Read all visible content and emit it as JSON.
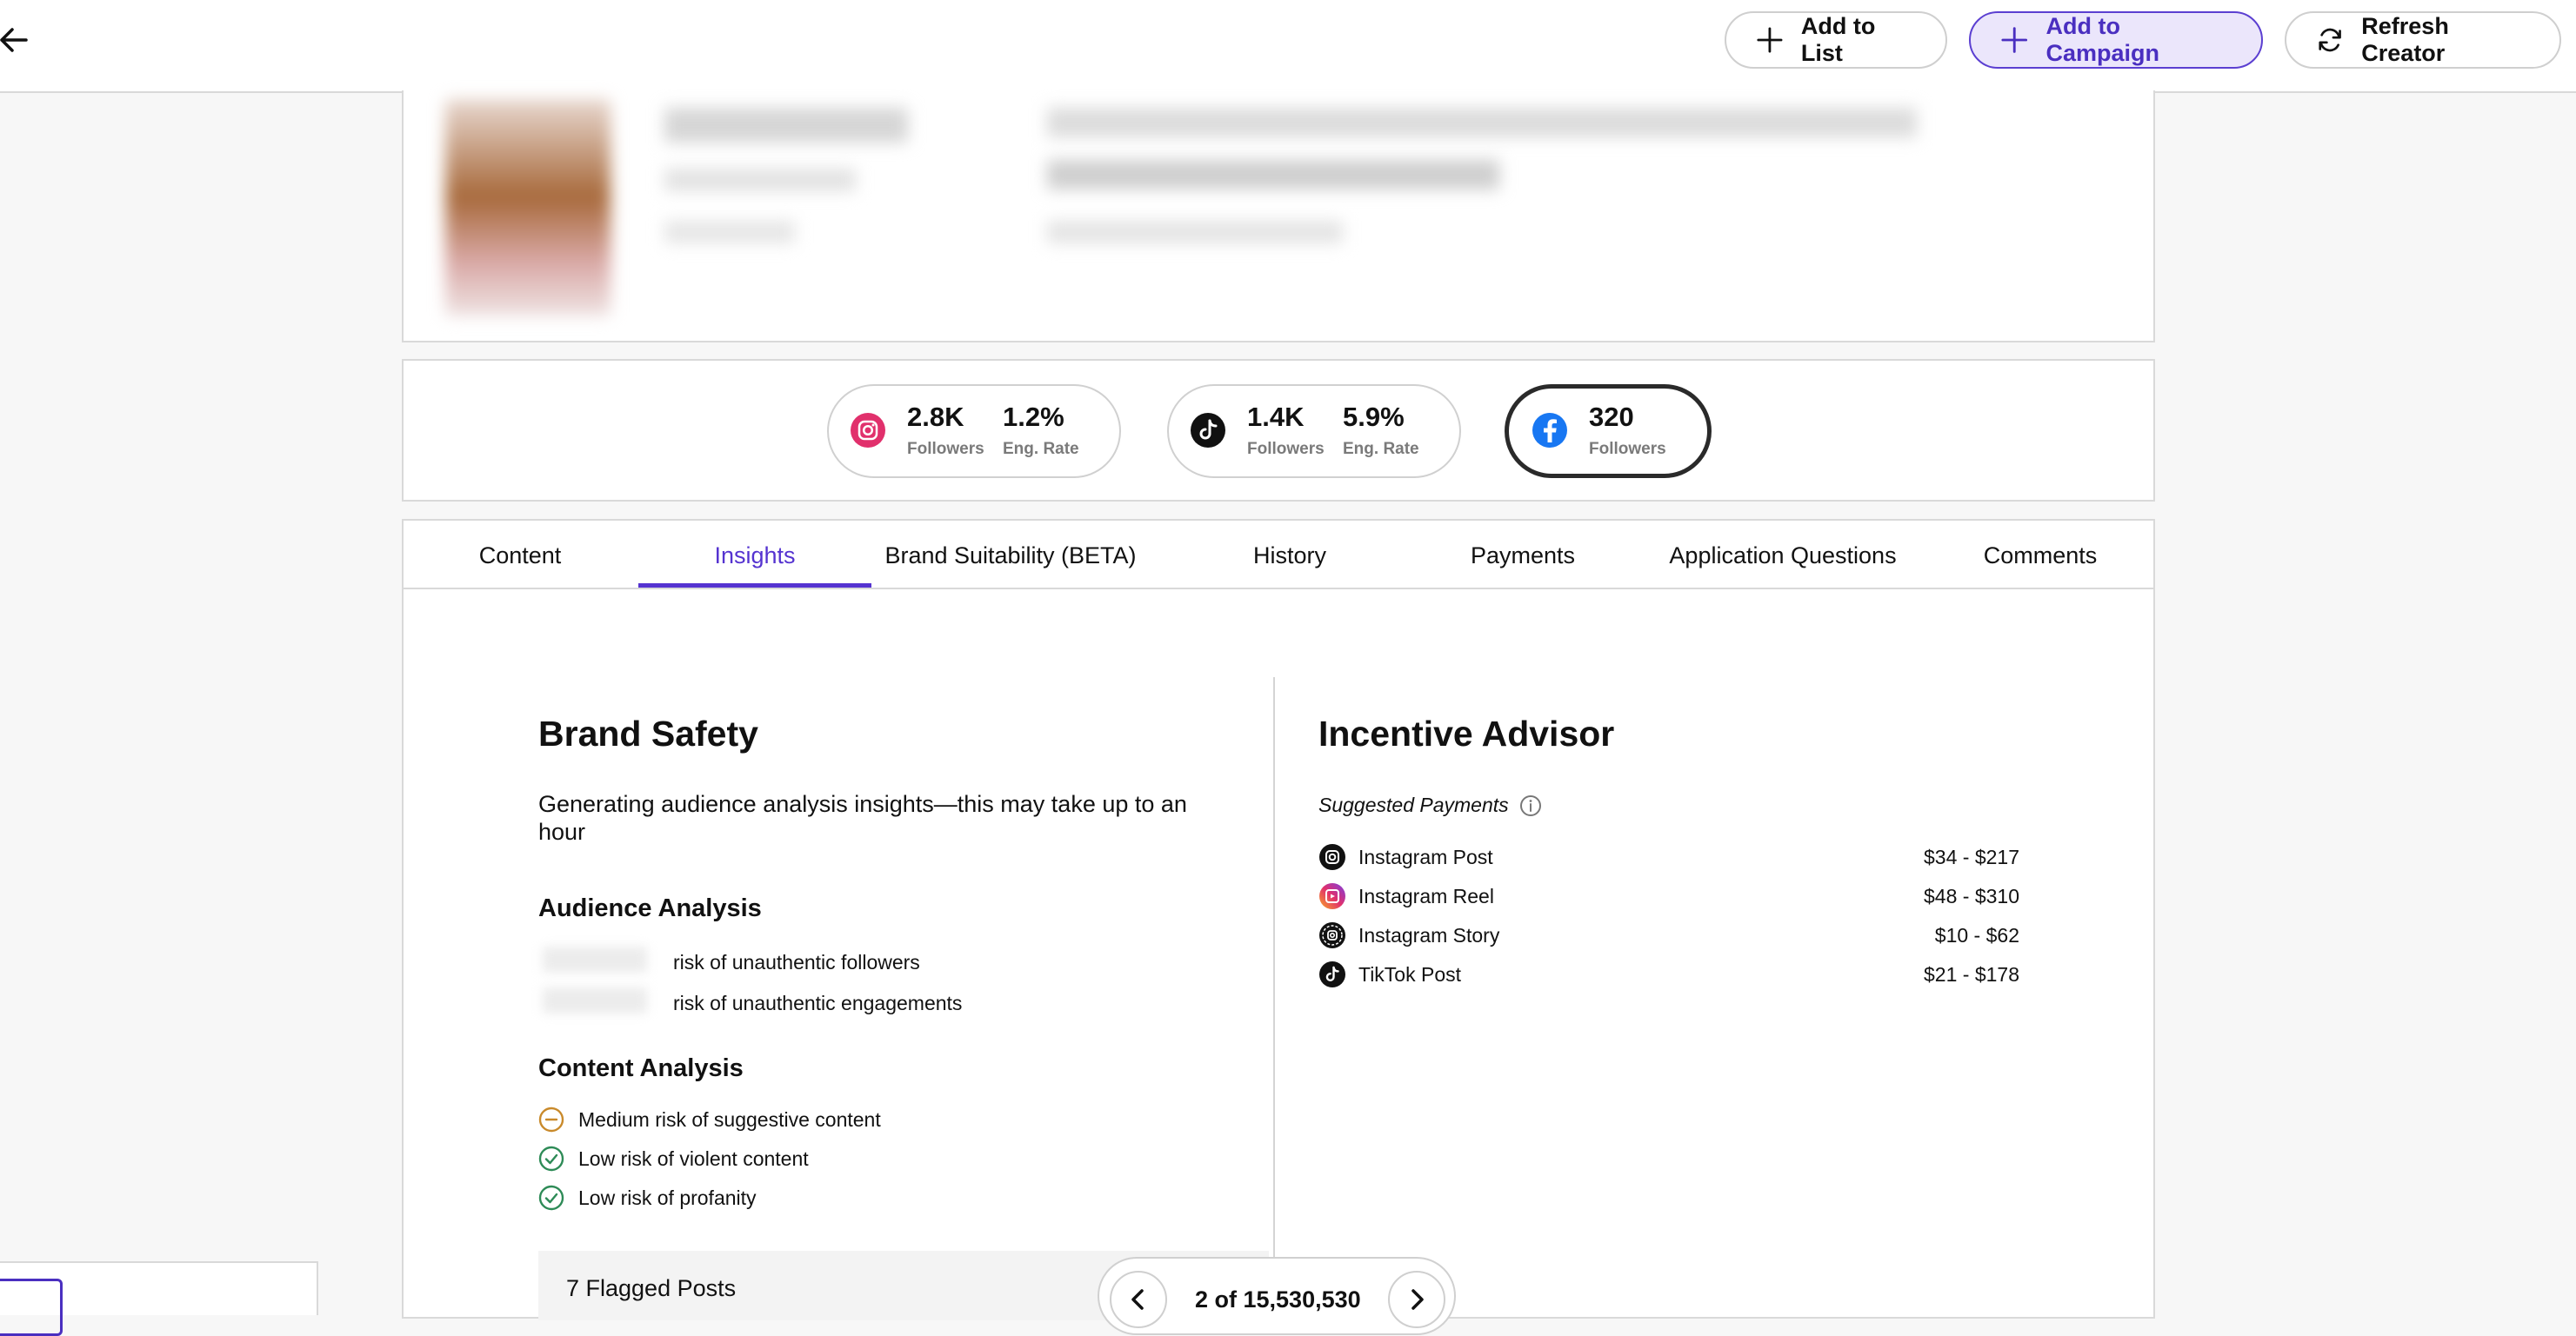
{
  "topbar": {
    "add_to_list": "Add to List",
    "add_to_campaign": "Add to Campaign",
    "refresh_creator": "Refresh Creator"
  },
  "stats": [
    {
      "platform": "instagram",
      "followers": "2.8K",
      "followers_label": "Followers",
      "eng_rate": "1.2%",
      "eng_label": "Eng. Rate"
    },
    {
      "platform": "tiktok",
      "followers": "1.4K",
      "followers_label": "Followers",
      "eng_rate": "5.9%",
      "eng_label": "Eng. Rate"
    },
    {
      "platform": "facebook",
      "followers": "320",
      "followers_label": "Followers",
      "selected": true
    }
  ],
  "tabs": [
    "Content",
    "Insights",
    "Brand Suitability (BETA)",
    "History",
    "Payments",
    "Application Questions",
    "Comments"
  ],
  "active_tab": "Insights",
  "brand_safety": {
    "title": "Brand Safety",
    "generating": "Generating audience analysis insights—this may take up to an hour",
    "audience_title": "Audience Analysis",
    "audience_items": [
      "risk of unauthentic followers",
      "risk of unauthentic engagements"
    ],
    "content_title": "Content Analysis",
    "content_items": [
      {
        "text": "Medium risk of suggestive content",
        "level": "medium",
        "color": "#c98a2b"
      },
      {
        "text": "Low risk of violent content",
        "level": "low",
        "color": "#2e8b57"
      },
      {
        "text": "Low risk of profanity",
        "level": "low",
        "color": "#2e8b57"
      }
    ],
    "flagged_posts": "7 Flagged Posts"
  },
  "incentive": {
    "title": "Incentive Advisor",
    "suggested_label": "Suggested Payments",
    "payments": [
      {
        "type": "Instagram Post",
        "range": "$34 - $217",
        "icon": "instagram-icon"
      },
      {
        "type": "Instagram Reel",
        "range": "$48 - $310",
        "icon": "instagram-reel-icon"
      },
      {
        "type": "Instagram Story",
        "range": "$10 - $62",
        "icon": "instagram-story-icon"
      },
      {
        "type": "TikTok Post",
        "range": "$21 - $178",
        "icon": "tiktok-icon"
      }
    ]
  },
  "pager": {
    "text": "2 of 15,530,530"
  },
  "colors": {
    "accent": "#5533d0",
    "instagram": "#e1306c",
    "facebook": "#1877f2"
  }
}
